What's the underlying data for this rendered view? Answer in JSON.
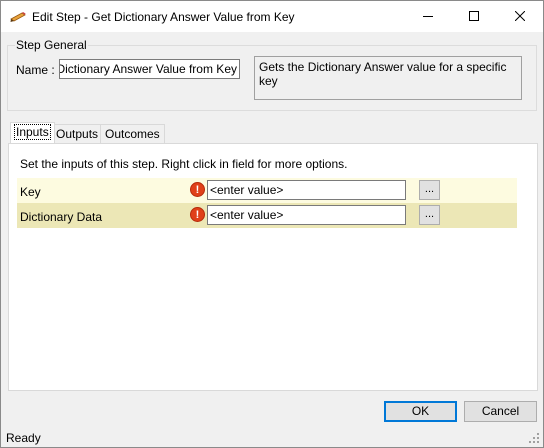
{
  "window": {
    "title": "Edit Step - Get Dictionary Answer Value from Key",
    "icon": "pencil-icon"
  },
  "titlebar_buttons": {
    "minimize_icon": "minimize-icon",
    "maximize_icon": "maximize-icon",
    "close_icon": "close-icon"
  },
  "step_general": {
    "legend": "Step General",
    "name_label": "Name :",
    "name_value": "Get Dictionary Answer Value from Key",
    "description": "Gets the Dictionary Answer value for a specific key"
  },
  "tabs": [
    {
      "label": "Inputs",
      "active": true
    },
    {
      "label": "Outputs",
      "active": false
    },
    {
      "label": "Outcomes",
      "active": false
    }
  ],
  "inputs_panel": {
    "hint": "Set the inputs of this step.  Right click in field for more options.",
    "rows": [
      {
        "label": "Key",
        "value": "<enter value>",
        "button": "...",
        "warning_icon": "error-icon"
      },
      {
        "label": "Dictionary Data",
        "value": "<enter value>",
        "button": "...",
        "warning_icon": "error-icon"
      }
    ]
  },
  "buttons": {
    "ok": "OK",
    "cancel": "Cancel"
  },
  "status": {
    "text": "Ready"
  },
  "colors": {
    "row_odd": "#fdfbe0",
    "row_even": "#ece7b6",
    "error": "#e0401a",
    "focus": "#0078d7"
  }
}
